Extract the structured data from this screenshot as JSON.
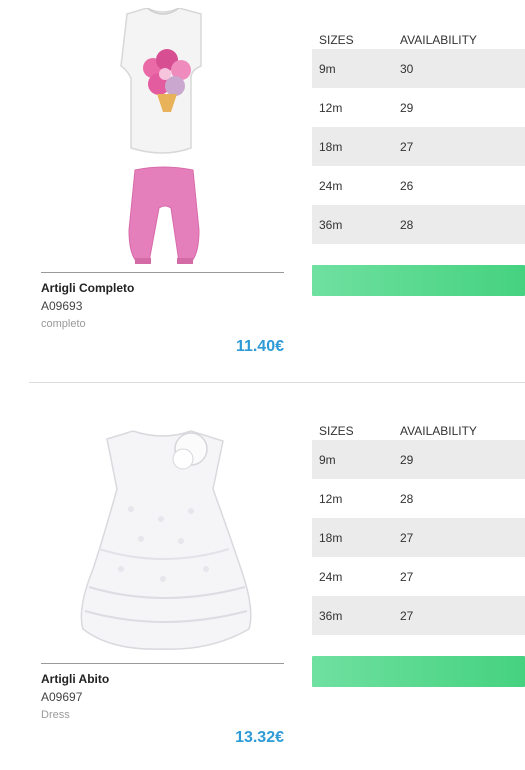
{
  "products": [
    {
      "name": "Artigli Completo",
      "code": "A09693",
      "category": "completo",
      "price": "11.40€",
      "image_icon": "shirt-and-pants-icon",
      "table": {
        "header_sizes": "SIZES",
        "header_availability": "AVAILABILITY",
        "rows": [
          {
            "size": "9m",
            "availability": "30"
          },
          {
            "size": "12m",
            "availability": "29"
          },
          {
            "size": "18m",
            "availability": "27"
          },
          {
            "size": "24m",
            "availability": "26"
          },
          {
            "size": "36m",
            "availability": "28"
          }
        ]
      },
      "action_color": "#4fd588"
    },
    {
      "name": "Artigli Abito",
      "code": "A09697",
      "category": "Dress",
      "price": "13.32€",
      "image_icon": "dress-icon",
      "table": {
        "header_sizes": "SIZES",
        "header_availability": "AVAILABILITY",
        "rows": [
          {
            "size": "9m",
            "availability": "29"
          },
          {
            "size": "12m",
            "availability": "28"
          },
          {
            "size": "18m",
            "availability": "27"
          },
          {
            "size": "24m",
            "availability": "27"
          },
          {
            "size": "36m",
            "availability": "27"
          }
        ]
      },
      "action_color": "#4fd588"
    }
  ],
  "colors": {
    "price": "#2e9bd6",
    "row_shade": "#ebebeb"
  }
}
